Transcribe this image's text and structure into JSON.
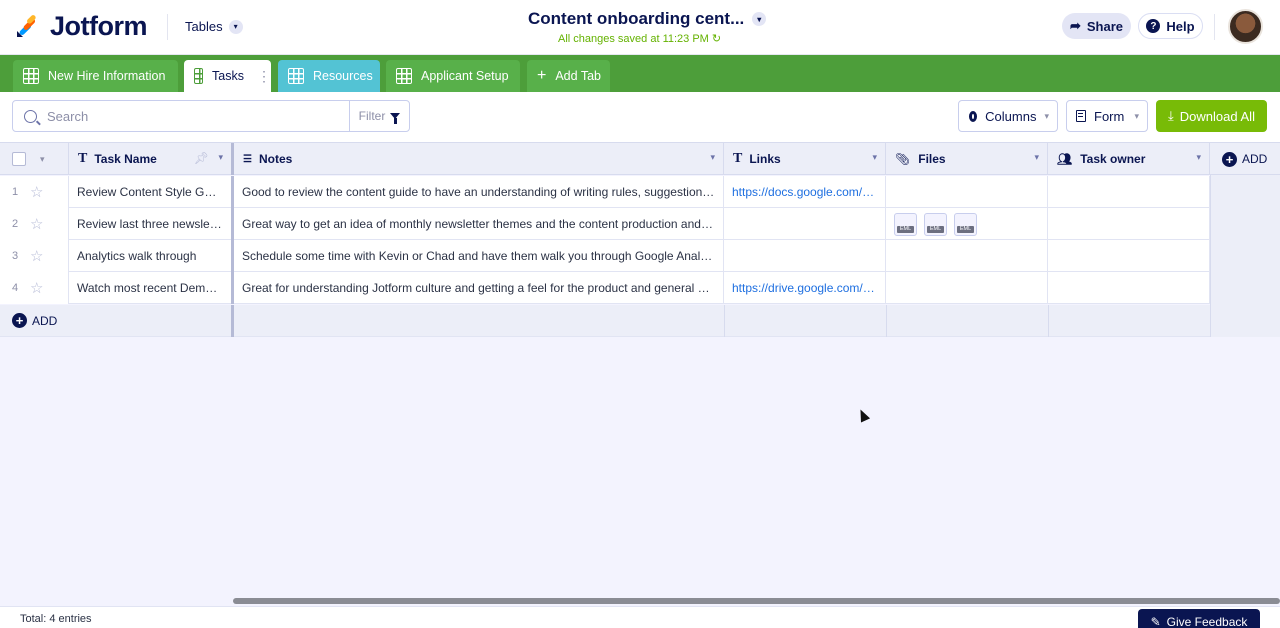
{
  "app": {
    "brand": "Jotform",
    "tables_label": "Tables",
    "doc_title": "Content onboarding cent...",
    "save_status": "All changes saved at 11:23 PM",
    "share_label": "Share",
    "help_label": "Help"
  },
  "tabs": [
    {
      "label": "New Hire Information"
    },
    {
      "label": "Tasks"
    },
    {
      "label": "Resources"
    },
    {
      "label": "Applicant Setup"
    },
    {
      "label": "Add Tab"
    }
  ],
  "toolbar": {
    "search_placeholder": "Search",
    "filter_label": "Filter",
    "columns_label": "Columns",
    "form_label": "Form",
    "download_label": "Download All"
  },
  "table": {
    "columns": [
      "Task Name",
      "Notes",
      "Links",
      "Files",
      "Task owner"
    ],
    "add_column_label": "ADD",
    "add_row_label": "ADD",
    "rows": [
      {
        "num": "1",
        "task": "Review Content Style Guide",
        "notes": "Good to review the content guide to have an understanding of writing rules, suggestions and best practices.",
        "link": "https://docs.google.com/document",
        "files": []
      },
      {
        "num": "2",
        "task": "Review last three newsletter",
        "notes": "Great way to get an idea of monthly newsletter themes and the content production and knowledge base.",
        "link": "",
        "files": [
          "EML",
          "EML",
          "EML"
        ]
      },
      {
        "num": "3",
        "task": "Analytics walk through",
        "notes": "Schedule some time with Kevin or Chad and have them walk you through Google Analytics dashboards.",
        "link": "",
        "files": []
      },
      {
        "num": "4",
        "task": "Watch most recent Demo Day",
        "notes": "Great for understanding Jotform culture and getting a feel for the product and general workflow.",
        "link": "https://drive.google.com/file",
        "files": []
      }
    ]
  },
  "footer": {
    "total": "Total: 4 entries",
    "feedback_label": "Give Feedback"
  },
  "colors": {
    "tab_bar": "#4d9e3a",
    "accent_navy": "#0a1551",
    "download": "#78bb07",
    "link": "#1e6fe0"
  }
}
